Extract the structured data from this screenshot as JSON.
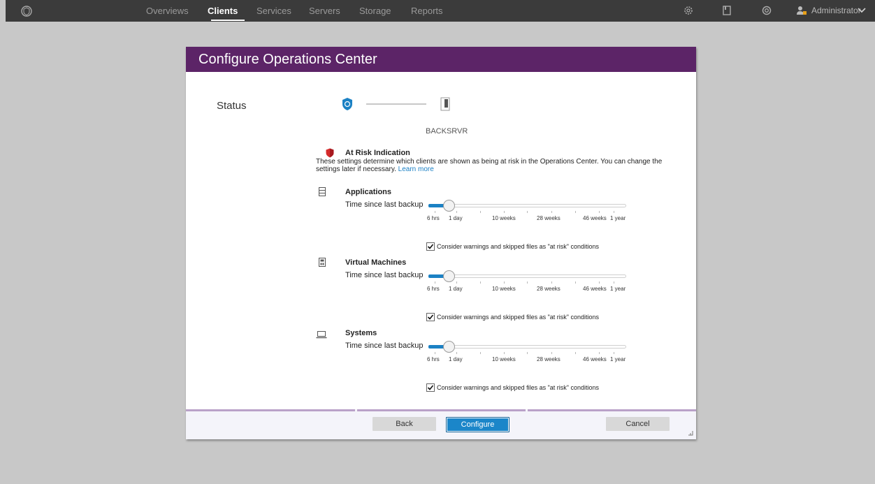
{
  "nav": {
    "items": [
      {
        "label": "Overviews"
      },
      {
        "label": "Clients"
      },
      {
        "label": "Services"
      },
      {
        "label": "Servers"
      },
      {
        "label": "Storage"
      },
      {
        "label": "Reports"
      }
    ],
    "active_index": 1,
    "user": "Administrator"
  },
  "dialog": {
    "title": "Configure Operations Center",
    "status_label": "Status",
    "server_name": "BACKSRVR",
    "risk": {
      "title": "At Risk Indication",
      "description": "These settings determine which clients are shown as being at risk in the Operations Center. You can change the settings later if necessary.",
      "learn_more": "Learn more"
    },
    "sections": [
      {
        "title": "Applications",
        "label": "Time since last backup",
        "value": "1 day",
        "ticks": [
          "6 hrs",
          "1 day",
          "10 weeks",
          "28 weeks",
          "46 weeks",
          "1 year"
        ],
        "checkbox_label": "Consider warnings and skipped files as \"at risk\" conditions",
        "checked": true
      },
      {
        "title": "Virtual Machines",
        "label": "Time since last backup",
        "value": "1 day",
        "ticks": [
          "6 hrs",
          "1 day",
          "10 weeks",
          "28 weeks",
          "46 weeks",
          "1 year"
        ],
        "checkbox_label": "Consider warnings and skipped files as \"at risk\" conditions",
        "checked": true
      },
      {
        "title": "Systems",
        "label": "Time since last backup",
        "value": "1 day",
        "ticks": [
          "6 hrs",
          "1 day",
          "10 weeks",
          "28 weeks",
          "46 weeks",
          "1 year"
        ],
        "checkbox_label": "Consider warnings and skipped files as \"at risk\" conditions",
        "checked": true
      }
    ],
    "buttons": {
      "back": "Back",
      "configure": "Configure",
      "cancel": "Cancel"
    }
  },
  "colors": {
    "header_purple": "#5c2467",
    "accent_blue": "#1b81c4",
    "topbar": "#3b3b3b"
  }
}
